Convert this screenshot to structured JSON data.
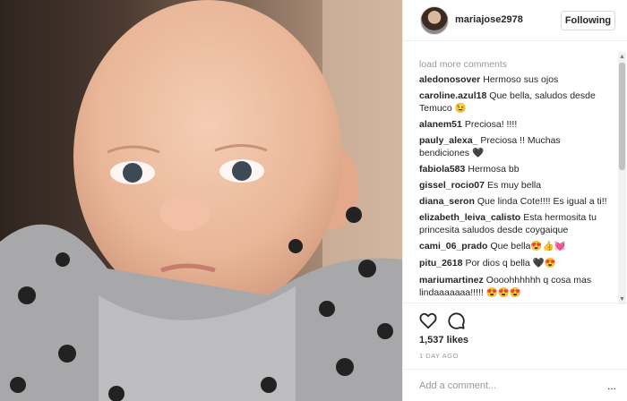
{
  "post": {
    "username": "mariajose2978",
    "follow_label": "Following",
    "load_more": "load more comments",
    "comments": [
      {
        "user": "aledonosover",
        "text": "Hermoso sus ojos"
      },
      {
        "user": "caroline.azul18",
        "text": "Que bella, saludos desde Temuco 😉"
      },
      {
        "user": "alanem51",
        "text": "Preciosa! !!!!"
      },
      {
        "user": "pauly_alexa_",
        "text": "Preciosa !! Muchas bendiciones 🖤"
      },
      {
        "user": "fabiola583",
        "text": "Hermosa bb"
      },
      {
        "user": "gissel_rocio07",
        "text": "Es muy bella"
      },
      {
        "user": "diana_seron",
        "text": "Que linda Cote!!!! Es igual a ti!!"
      },
      {
        "user": "elizabeth_leiva_calisto",
        "text": "Esta hermosita tu princesita saludos desde coygaique"
      },
      {
        "user": "cami_06_prado",
        "text": "Que bella😍👍💓"
      },
      {
        "user": "pitu_2618",
        "text": "Por dios q bella 🖤😍"
      },
      {
        "user": "mariumartinez",
        "text": "Oooohhhhhh q cosa mas lindaaaaaaa!!!!! 😍😍😍"
      }
    ],
    "likes": "1,537 likes",
    "time": "1 DAY AGO",
    "comment_placeholder": "Add a comment...",
    "more_label": "..."
  }
}
